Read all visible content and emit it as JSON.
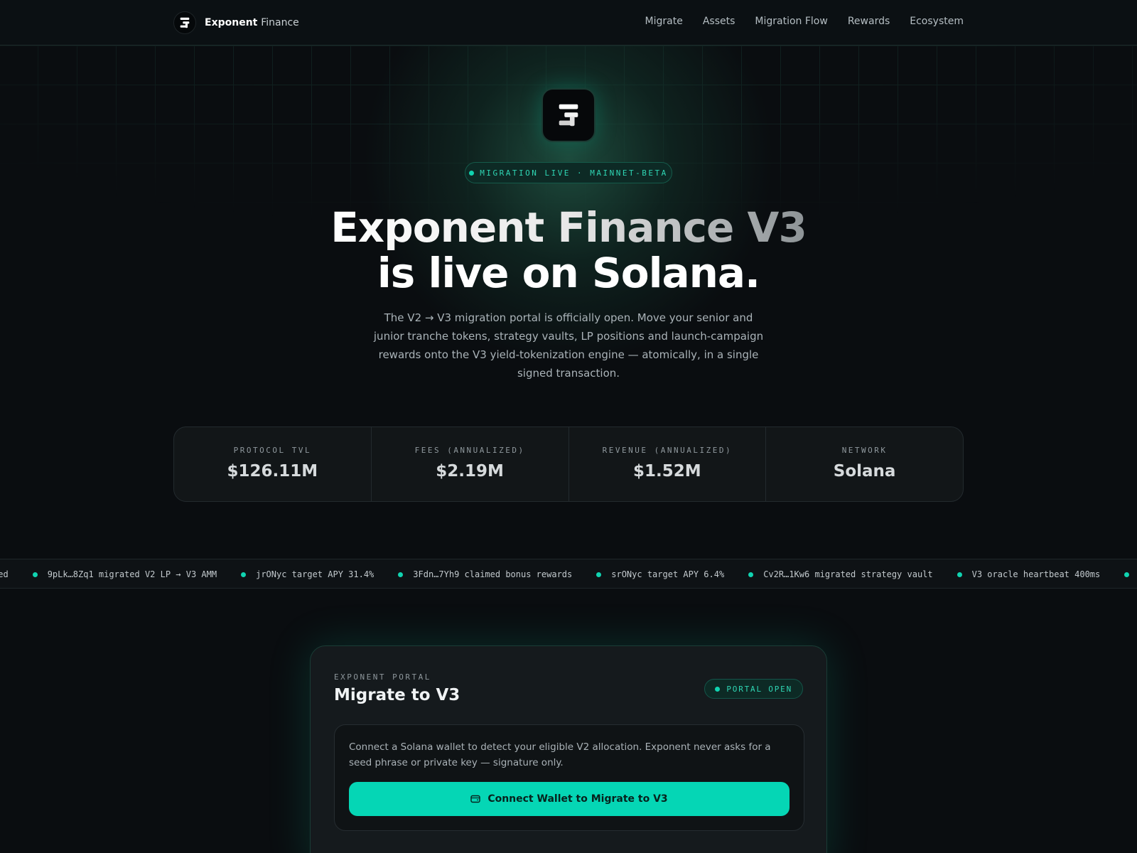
{
  "nav": {
    "brand_primary": "Exponent",
    "brand_secondary": "Finance",
    "links": [
      "Migrate",
      "Assets",
      "Migration Flow",
      "Rewards",
      "Ecosystem"
    ]
  },
  "hero": {
    "badge": "MIGRATION LIVE · MAINNET-BETA",
    "title_line1": "Exponent Finance V3",
    "title_line2": "is live on Solana.",
    "lead": "The V2 → V3 migration portal is officially open. Move your senior and junior tranche tokens, strategy vaults, LP positions and launch-campaign rewards onto the V3 yield-tokenization engine — atomically, in a single signed transaction."
  },
  "stats": [
    {
      "label": "PROTOCOL TVL",
      "value": "$126.11M"
    },
    {
      "label": "FEES (ANNUALIZED)",
      "value": "$2.19M"
    },
    {
      "label": "REVENUE (ANNUALIZED)",
      "value": "$1.52M"
    },
    {
      "label": "NETWORK",
      "value": "Solana"
    }
  ],
  "ticker": {
    "leading": "led",
    "items": [
      "9pLk…8Zq1 migrated V2 LP → V3 AMM",
      "jrONyc target APY 31.4%",
      "3Fdn…7Yh9 claimed bonus rewards",
      "srONyc target APY 6.4%",
      "Cv2R…1Kw6 migrated strategy vault",
      "V3 oracle heartbeat 400ms"
    ]
  },
  "portal": {
    "eyebrow": "EXPONENT PORTAL",
    "title": "Migrate to V3",
    "status": "PORTAL OPEN",
    "connect_text": "Connect a Solana wallet to detect your eligible V2 allocation. Exponent never asks for a seed phrase or private key — signature only.",
    "connect_button": "Connect Wallet to Migrate to V3"
  },
  "colors": {
    "accent": "#05d6b5",
    "background": "#0a0d10",
    "panel": "#151a1d"
  }
}
